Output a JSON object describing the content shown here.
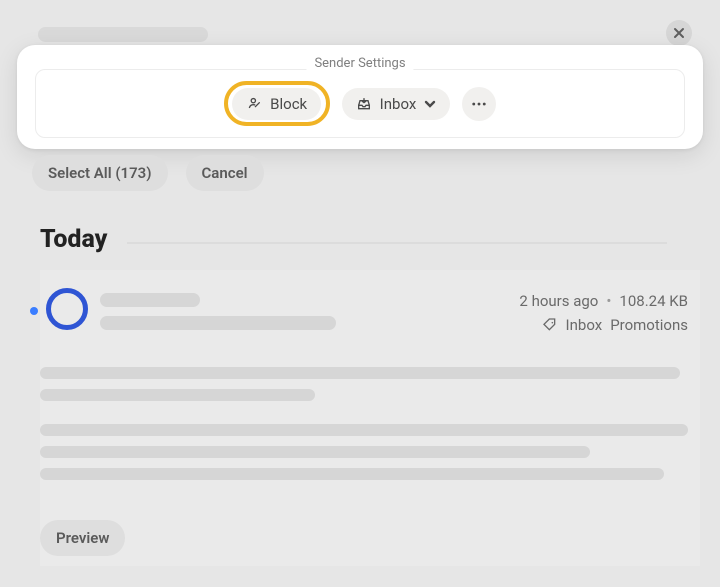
{
  "settings": {
    "title": "Sender Settings",
    "block_label": "Block",
    "move_label": "Inbox"
  },
  "actions": {
    "select_all_label": "Select All (173)",
    "cancel_label": "Cancel"
  },
  "section": {
    "title": "Today"
  },
  "message": {
    "time": "2 hours ago",
    "size": "108.24 KB",
    "labels": {
      "inbox": "Inbox",
      "promotions": "Promotions"
    },
    "preview_label": "Preview"
  }
}
